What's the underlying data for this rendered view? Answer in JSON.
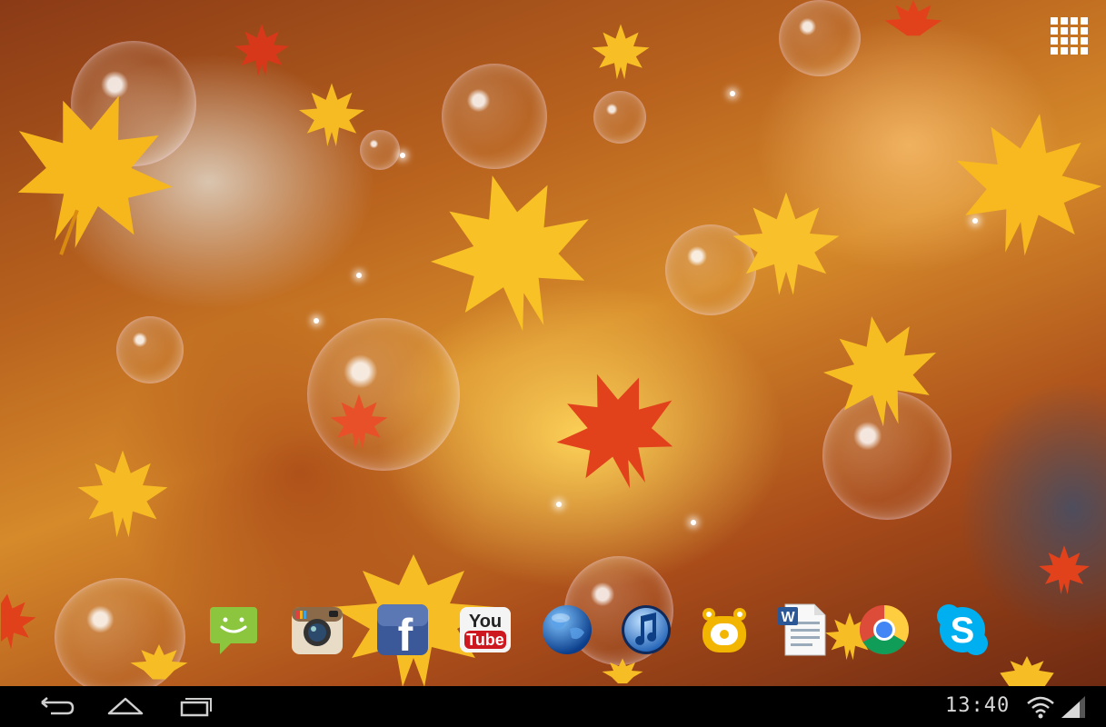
{
  "wallpaper": {
    "theme": "autumn-leaves-bubbles",
    "accent_colors": [
      "#f5b51c",
      "#e2421b",
      "#c56a22"
    ]
  },
  "launcher": {
    "apps_button_icon": "apps-grid-icon",
    "dock_apps": [
      {
        "name": "Messaging",
        "icon": "messaging-icon",
        "color": "#8cc63f"
      },
      {
        "name": "Instagram",
        "icon": "instagram-camera-icon",
        "color": "#8b6a4a"
      },
      {
        "name": "Facebook",
        "icon": "facebook-icon",
        "color": "#3b5998",
        "glyph": "f"
      },
      {
        "name": "YouTube",
        "icon": "youtube-icon",
        "color": "#cc181e",
        "label_top": "You",
        "label_bottom": "Tube"
      },
      {
        "name": "Browser",
        "icon": "globe-icon",
        "color": "#1f5fa8"
      },
      {
        "name": "Music",
        "icon": "music-note-icon",
        "color": "#2a73c9"
      },
      {
        "name": "GOM Player",
        "icon": "gom-player-icon",
        "color": "#f2b600"
      },
      {
        "name": "Word",
        "icon": "word-document-icon",
        "color": "#2b5797",
        "glyph": "W"
      },
      {
        "name": "Chrome",
        "icon": "chrome-icon",
        "color": "#dd4b39"
      },
      {
        "name": "Skype",
        "icon": "skype-icon",
        "color": "#00aff0",
        "glyph": "S"
      }
    ]
  },
  "system_bar": {
    "back_icon": "back-icon",
    "home_icon": "home-icon",
    "recents_icon": "recent-apps-icon",
    "time": "13:40",
    "wifi_icon": "wifi-icon",
    "signal_icon": "signal-icon"
  }
}
